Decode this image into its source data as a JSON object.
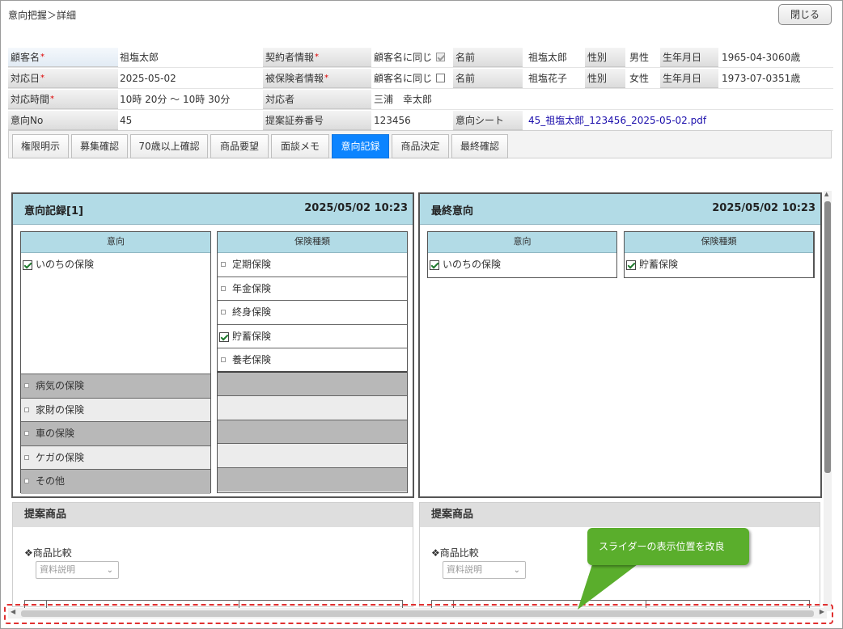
{
  "breadcrumb": "意向把握＞詳細",
  "close_button": "閉じる",
  "info": {
    "customer_name_label": "顧客名",
    "customer_name": "祖塩太郎",
    "contract_label": "契約者情報",
    "contract_same": "顧客名に同じ",
    "contract_name_label": "名前",
    "contract_name": "祖塩太郎",
    "contract_gender_label": "性別",
    "contract_gender": "男性",
    "contract_birth_label": "生年月日",
    "contract_birth": "1965-04-30",
    "contract_age": "60歳",
    "date_label": "対応日",
    "date": "2025-05-02",
    "insured_label": "被保険者情報",
    "insured_same": "顧客名に同じ",
    "insured_name_label": "名前",
    "insured_name": "祖塩花子",
    "insured_gender_label": "性別",
    "insured_gender": "女性",
    "insured_birth_label": "生年月日",
    "insured_birth": "1973-07-03",
    "insured_age": "51歳",
    "time_label": "対応時間",
    "time": "10時 20分 ～ 10時 30分",
    "handler_label": "対応者",
    "handler": "三浦　幸太郎",
    "intent_no_label": "意向No",
    "intent_no": "45",
    "proposal_no_label": "提案証券番号",
    "proposal_no": "123456",
    "sheet_label": "意向シート",
    "sheet_file": "45_祖塩太郎_123456_2025-05-02.pdf",
    "required_mark": "*"
  },
  "tabs": [
    "権限明示",
    "募集確認",
    "70歳以上確認",
    "商品要望",
    "面談メモ",
    "意向記録",
    "商品決定",
    "最終確認"
  ],
  "active_tab": "意向記録",
  "record_panel": {
    "title": "意向記録[1]",
    "datetime": "2025/05/02 10:23",
    "intent_header": "意向",
    "type_header": "保険種類",
    "intent_checked": "いのちの保険",
    "intent_items": [
      "病気の保険",
      "家財の保険",
      "車の保険",
      "ケガの保険",
      "その他"
    ],
    "type_items": [
      "定期保険",
      "年金保険",
      "終身保険",
      "貯蓄保険",
      "養老保険"
    ],
    "type_checked": "貯蓄保険"
  },
  "final_panel": {
    "title": "最終意向",
    "datetime": "2025/05/02 10:23",
    "intent_header": "意向",
    "type_header": "保険種類",
    "intent_checked": "いのちの保険",
    "type_checked": "貯蓄保険"
  },
  "proposal_left": {
    "title": "提案商品",
    "compare_label": "❖商品比較",
    "select_value": "資料説明"
  },
  "proposal_right": {
    "title": "提案商品",
    "compare_label": "❖商品比較",
    "select_value": "資料説明"
  },
  "callout": "スライダーの表示位置を改良",
  "colors": {
    "accent_tab": "#0b84ff",
    "panel_header": "#b2dbe6",
    "callout": "#5aae2c",
    "dashed_highlight": "#e03030"
  }
}
